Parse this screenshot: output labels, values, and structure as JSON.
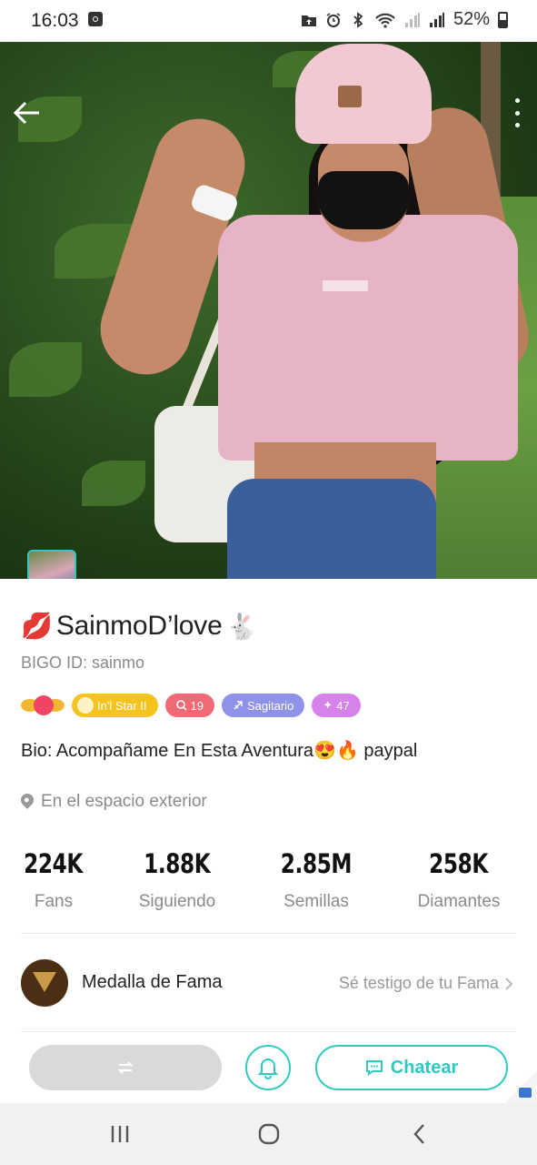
{
  "status_bar": {
    "time": "16:03",
    "battery": "52%"
  },
  "profile": {
    "display_name": "SainmoD’love",
    "name_emoji_left": "💋",
    "name_emoji_right": "🐇",
    "bigo_id": "BIGO ID: sainmo",
    "badges": {
      "star_label": "In'l Star II",
      "level": "19",
      "zodiac": "Sagitario",
      "number": "47"
    },
    "bio": "Bio: Acompañame En Esta Aventura😍🔥  paypal",
    "location": "En el espacio exterior"
  },
  "stats": [
    {
      "value": "224K",
      "label": "Fans"
    },
    {
      "value": "1.88K",
      "label": "Siguiendo"
    },
    {
      "value": "2.85M",
      "label": "Semillas"
    },
    {
      "value": "258K",
      "label": "Diamantes"
    }
  ],
  "fame": {
    "title": "Medalla de Fama",
    "link": "Sé testigo de tu Fama"
  },
  "actions": {
    "chat_label": "Chatear"
  },
  "carousel": {
    "total": 5,
    "active_index": 0
  },
  "colors": {
    "accent": "#2ec9bf",
    "star_pill": "#f4c31e",
    "level_pill": "#f06a75",
    "zodiac_pill": "#8e92e8",
    "number_pill": "#d781ea"
  }
}
